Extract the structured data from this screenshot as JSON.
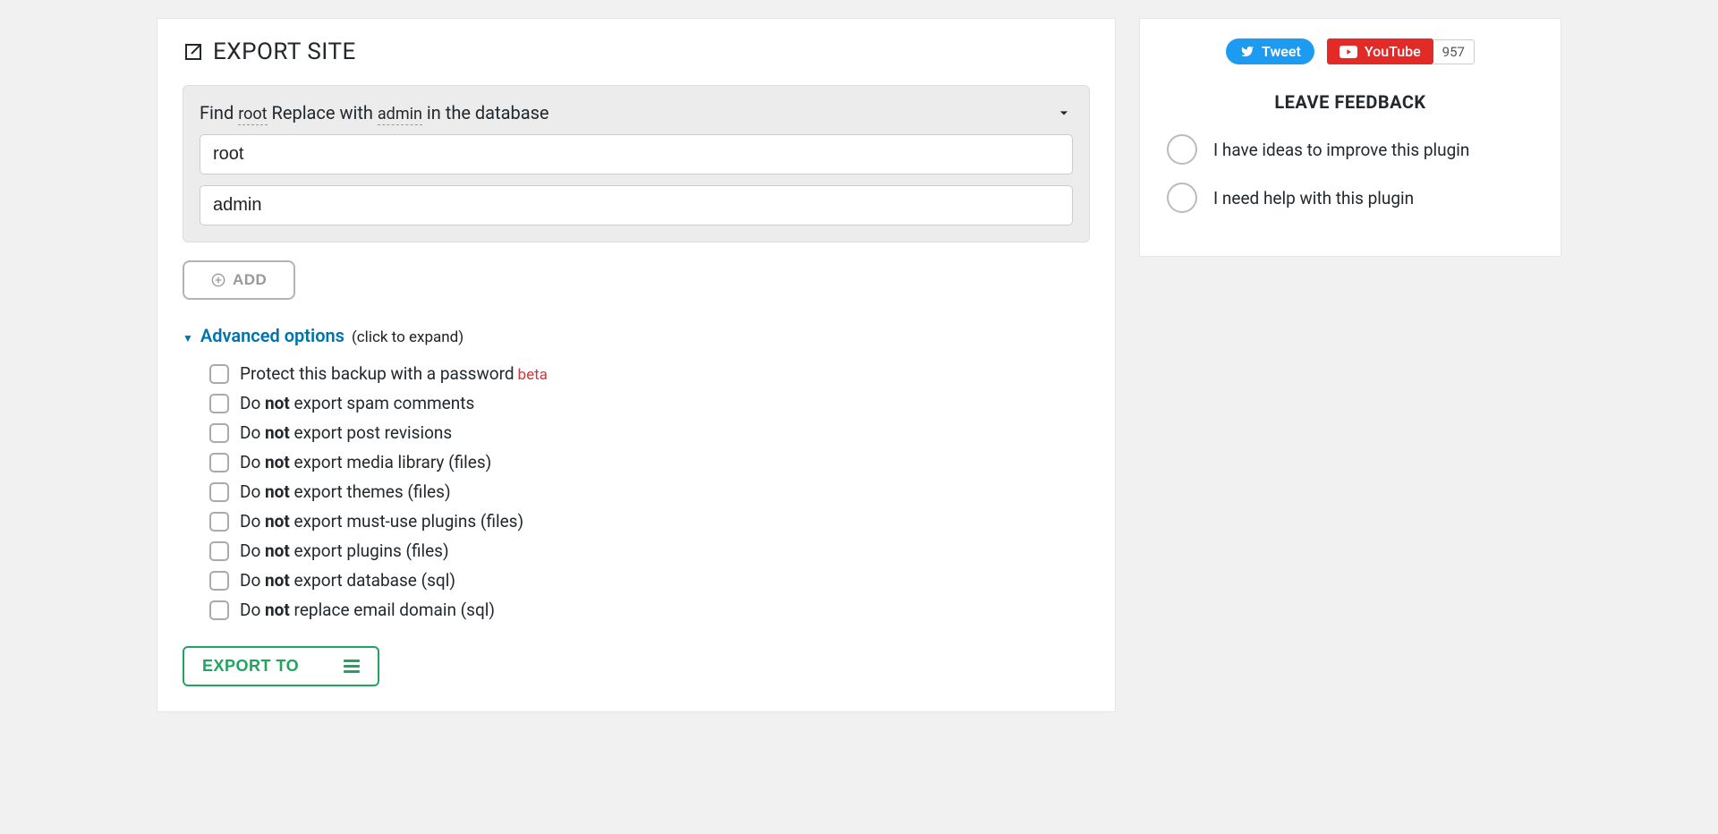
{
  "page": {
    "title": "EXPORT SITE"
  },
  "replaceBox": {
    "label_find": "Find",
    "find_value": "root",
    "label_replace": "Replace with",
    "replace_value": "admin",
    "label_suffix": "in the database",
    "input_find": "root",
    "input_replace": "admin"
  },
  "buttons": {
    "add": "ADD",
    "export": "EXPORT TO"
  },
  "advanced": {
    "title": "Advanced options",
    "hint": "(click to expand)",
    "options": [
      {
        "pre": "Protect this backup with a password",
        "bold": "",
        "post": "",
        "beta": "beta"
      },
      {
        "pre": "Do ",
        "bold": "not",
        "post": " export spam comments",
        "beta": ""
      },
      {
        "pre": "Do ",
        "bold": "not",
        "post": " export post revisions",
        "beta": ""
      },
      {
        "pre": "Do ",
        "bold": "not",
        "post": " export media library (files)",
        "beta": ""
      },
      {
        "pre": "Do ",
        "bold": "not",
        "post": " export themes (files)",
        "beta": ""
      },
      {
        "pre": "Do ",
        "bold": "not",
        "post": " export must-use plugins (files)",
        "beta": ""
      },
      {
        "pre": "Do ",
        "bold": "not",
        "post": " export plugins (files)",
        "beta": ""
      },
      {
        "pre": "Do ",
        "bold": "not",
        "post": " export database (sql)",
        "beta": ""
      },
      {
        "pre": "Do ",
        "bold": "not",
        "post": " replace email domain (sql)",
        "beta": ""
      }
    ]
  },
  "sidebar": {
    "tweet_label": "Tweet",
    "youtube_label": "YouTube",
    "youtube_count": "957",
    "feedback_heading": "LEAVE FEEDBACK",
    "feedback_options": [
      "I have ideas to improve this plugin",
      "I need help with this plugin"
    ]
  }
}
